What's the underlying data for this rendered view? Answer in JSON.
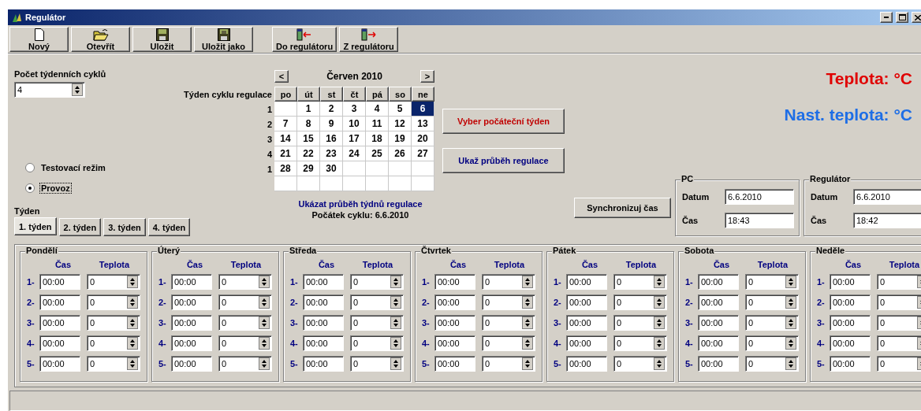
{
  "window": {
    "title": "Regulátor"
  },
  "toolbar": {
    "groups": [
      [
        {
          "label": "Nový",
          "kind": "new"
        },
        {
          "label": "Otevřít",
          "kind": "open"
        },
        {
          "label": "Uložit",
          "kind": "save"
        },
        {
          "label": "Uložit jako",
          "kind": "saveas"
        }
      ],
      [
        {
          "label": "Do regulátoru",
          "kind": "upload"
        },
        {
          "label": "Z regulátoru",
          "kind": "download"
        }
      ]
    ]
  },
  "cycles": {
    "label": "Počet týdenních cyklů",
    "value": "4"
  },
  "mode": [
    {
      "label": "Testovací režim",
      "selected": false
    },
    {
      "label": "Provoz",
      "selected": true
    }
  ],
  "week_tabs": {
    "label": "Týden",
    "tabs": [
      {
        "label": "1. týden",
        "selected": true
      },
      {
        "label": "2. týden",
        "selected": false
      },
      {
        "label": "3. týden",
        "selected": false
      },
      {
        "label": "4. týden",
        "selected": false
      }
    ]
  },
  "calendar": {
    "prev": "<",
    "month": "Červen 2010",
    "next": ">",
    "row_label": "Týden cyklu regulace",
    "weekdays": [
      "po",
      "út",
      "st",
      "čt",
      "pá",
      "so",
      "ne"
    ],
    "weeks": [
      {
        "number": "1",
        "days": [
          {
            "blank": true
          },
          {
            "text": "1",
            "selected": false
          },
          {
            "text": "2",
            "selected": false
          },
          {
            "text": "3",
            "selected": false
          },
          {
            "text": "4",
            "selected": false
          },
          {
            "text": "5",
            "selected": false
          },
          {
            "text": "6",
            "selected": true
          }
        ]
      },
      {
        "number": "2",
        "days": [
          {
            "text": "7",
            "selected": false
          },
          {
            "text": "8",
            "selected": false
          },
          {
            "text": "9",
            "selected": false
          },
          {
            "text": "10",
            "selected": false
          },
          {
            "text": "11",
            "selected": false
          },
          {
            "text": "12",
            "selected": false
          },
          {
            "text": "13",
            "selected": false
          }
        ]
      },
      {
        "number": "3",
        "days": [
          {
            "text": "14",
            "selected": false
          },
          {
            "text": "15",
            "selected": false
          },
          {
            "text": "16",
            "selected": false
          },
          {
            "text": "17",
            "selected": false
          },
          {
            "text": "18",
            "selected": false
          },
          {
            "text": "19",
            "selected": false
          },
          {
            "text": "20",
            "selected": false
          }
        ]
      },
      {
        "number": "4",
        "days": [
          {
            "text": "21",
            "selected": false
          },
          {
            "text": "22",
            "selected": false
          },
          {
            "text": "23",
            "selected": false
          },
          {
            "text": "24",
            "selected": false
          },
          {
            "text": "25",
            "selected": false
          },
          {
            "text": "26",
            "selected": false
          },
          {
            "text": "27",
            "selected": false
          }
        ]
      },
      {
        "number": "1",
        "days": [
          {
            "text": "28",
            "selected": false
          },
          {
            "text": "29",
            "selected": false
          },
          {
            "text": "30",
            "selected": false
          },
          {
            "blank": true
          },
          {
            "blank": true
          },
          {
            "blank": true
          },
          {
            "blank": true
          }
        ]
      },
      {
        "days": [
          {
            "blank": true
          },
          {
            "blank": true
          },
          {
            "blank": true
          },
          {
            "blank": true
          },
          {
            "blank": true
          },
          {
            "blank": true
          },
          {
            "blank": true
          }
        ]
      }
    ],
    "link": "Ukázat průběh týdnů regulace",
    "start": "Počátek cyklu: 6.6.2010"
  },
  "actions": [
    {
      "label": "Vyber počáteční týden",
      "color": "#c00000"
    },
    {
      "label": "Ukaž průběh regulace",
      "color": "#000080"
    }
  ],
  "temperature": {
    "current": "Teplota: °C",
    "setpoint": "Nast. teplota: °C"
  },
  "sync_button": "Synchronizuj čas",
  "clocks": [
    {
      "title": "PC",
      "date_label": "Datum",
      "date": "6.6.2010",
      "time_label": "Čas",
      "time": "18:43"
    },
    {
      "title": "Regulátor",
      "date_label": "Datum",
      "date": "6.6.2010",
      "time_label": "Čas",
      "time": "18:42"
    }
  ],
  "days": [
    {
      "name": "Pondělí",
      "time_header": "Čas",
      "temp_header": "Teplota",
      "slots": [
        {
          "index": "1-",
          "time": "00:00",
          "temp": "0"
        },
        {
          "index": "2-",
          "time": "00:00",
          "temp": "0"
        },
        {
          "index": "3-",
          "time": "00:00",
          "temp": "0"
        },
        {
          "index": "4-",
          "time": "00:00",
          "temp": "0"
        },
        {
          "index": "5-",
          "time": "00:00",
          "temp": "0"
        }
      ]
    },
    {
      "name": "Úterý",
      "time_header": "Čas",
      "temp_header": "Teplota",
      "slots": [
        {
          "index": "1-",
          "time": "00:00",
          "temp": "0"
        },
        {
          "index": "2-",
          "time": "00:00",
          "temp": "0"
        },
        {
          "index": "3-",
          "time": "00:00",
          "temp": "0"
        },
        {
          "index": "4-",
          "time": "00:00",
          "temp": "0"
        },
        {
          "index": "5-",
          "time": "00:00",
          "temp": "0"
        }
      ]
    },
    {
      "name": "Středa",
      "time_header": "Čas",
      "temp_header": "Teplota",
      "slots": [
        {
          "index": "1-",
          "time": "00:00",
          "temp": "0"
        },
        {
          "index": "2-",
          "time": "00:00",
          "temp": "0"
        },
        {
          "index": "3-",
          "time": "00:00",
          "temp": "0"
        },
        {
          "index": "4-",
          "time": "00:00",
          "temp": "0"
        },
        {
          "index": "5-",
          "time": "00:00",
          "temp": "0"
        }
      ]
    },
    {
      "name": "Čtvrtek",
      "time_header": "Čas",
      "temp_header": "Teplota",
      "slots": [
        {
          "index": "1-",
          "time": "00:00",
          "temp": "0"
        },
        {
          "index": "2-",
          "time": "00:00",
          "temp": "0"
        },
        {
          "index": "3-",
          "time": "00:00",
          "temp": "0"
        },
        {
          "index": "4-",
          "time": "00:00",
          "temp": "0"
        },
        {
          "index": "5-",
          "time": "00:00",
          "temp": "0"
        }
      ]
    },
    {
      "name": "Pátek",
      "time_header": "Čas",
      "temp_header": "Teplota",
      "slots": [
        {
          "index": "1-",
          "time": "00:00",
          "temp": "0"
        },
        {
          "index": "2-",
          "time": "00:00",
          "temp": "0"
        },
        {
          "index": "3-",
          "time": "00:00",
          "temp": "0"
        },
        {
          "index": "4-",
          "time": "00:00",
          "temp": "0"
        },
        {
          "index": "5-",
          "time": "00:00",
          "temp": "0"
        }
      ]
    },
    {
      "name": "Sobota",
      "time_header": "Čas",
      "temp_header": "Teplota",
      "slots": [
        {
          "index": "1-",
          "time": "00:00",
          "temp": "0"
        },
        {
          "index": "2-",
          "time": "00:00",
          "temp": "0"
        },
        {
          "index": "3-",
          "time": "00:00",
          "temp": "0"
        },
        {
          "index": "4-",
          "time": "00:00",
          "temp": "0"
        },
        {
          "index": "5-",
          "time": "00:00",
          "temp": "0"
        }
      ]
    },
    {
      "name": "Neděle",
      "time_header": "Čas",
      "temp_header": "Teplota",
      "slots": [
        {
          "index": "1-",
          "time": "00:00",
          "temp": "0"
        },
        {
          "index": "2-",
          "time": "00:00",
          "temp": "0"
        },
        {
          "index": "3-",
          "time": "00:00",
          "temp": "0"
        },
        {
          "index": "4-",
          "time": "00:00",
          "temp": "0"
        },
        {
          "index": "5-",
          "time": "00:00",
          "temp": "0"
        }
      ]
    }
  ]
}
